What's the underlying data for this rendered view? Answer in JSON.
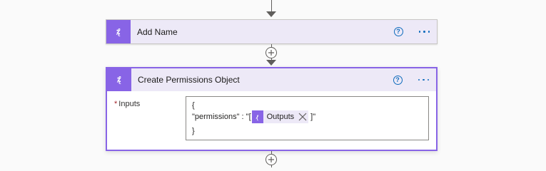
{
  "colors": {
    "accent": "#8864e6",
    "header_bg": "#ede9f7",
    "link": "#0f6cbd",
    "required": "#a4262c"
  },
  "actions": [
    {
      "title": "Add Name",
      "icon": "variable-braces-icon",
      "help_icon": "question-circle-icon",
      "more_icon": "ellipsis-icon"
    },
    {
      "title": "Create Permissions Object",
      "icon": "variable-braces-icon",
      "help_icon": "question-circle-icon",
      "more_icon": "ellipsis-icon",
      "inputs": {
        "label": "Inputs",
        "required_mark": "*",
        "line1": "{",
        "line2_prefix": "\"permissions\" : \"[",
        "token_label": "Outputs",
        "line2_suffix": "]\"",
        "line3": "}"
      }
    }
  ],
  "connectors": {
    "insert_icon": "plus-circle-icon",
    "arrow_icon": "arrow-down-icon"
  }
}
